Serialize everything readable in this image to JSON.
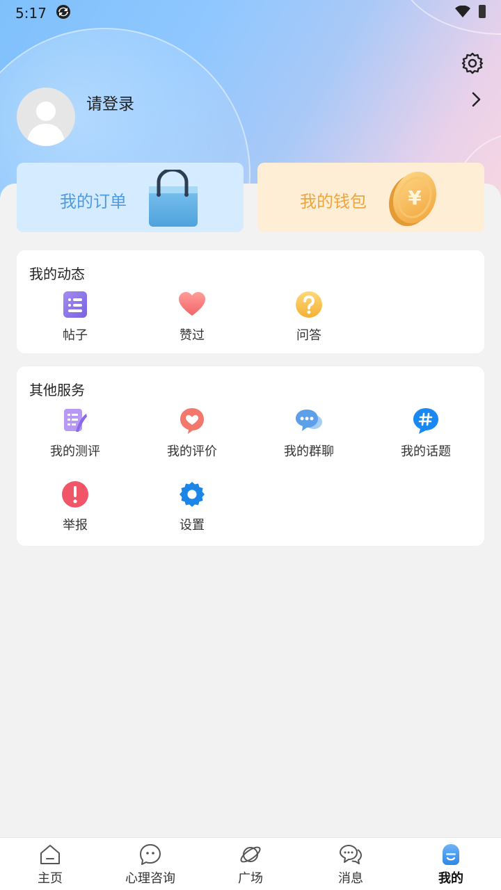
{
  "status_bar": {
    "time": "5:17"
  },
  "profile": {
    "login_text": "请登录"
  },
  "cards": {
    "orders_label": "我的订单",
    "wallet_label": "我的钱包",
    "coin_symbol": "¥"
  },
  "activity": {
    "title": "我的动态",
    "items": [
      {
        "label": "帖子",
        "icon": "post-icon"
      },
      {
        "label": "赞过",
        "icon": "heart-icon"
      },
      {
        "label": "问答",
        "icon": "question-icon"
      }
    ]
  },
  "services": {
    "title": "其他服务",
    "items": [
      {
        "label": "我的测评",
        "icon": "assessment-icon"
      },
      {
        "label": "我的评价",
        "icon": "review-icon"
      },
      {
        "label": "我的群聊",
        "icon": "group-chat-icon"
      },
      {
        "label": "我的话题",
        "icon": "topic-icon"
      },
      {
        "label": "举报",
        "icon": "report-icon"
      },
      {
        "label": "设置",
        "icon": "settings-icon"
      }
    ]
  },
  "tabbar": {
    "items": [
      {
        "label": "主页",
        "icon": "home-icon"
      },
      {
        "label": "心理咨询",
        "icon": "consult-icon"
      },
      {
        "label": "广场",
        "icon": "planet-icon"
      },
      {
        "label": "消息",
        "icon": "message-icon"
      },
      {
        "label": "我的",
        "icon": "profile-icon",
        "active": true
      }
    ]
  },
  "colors": {
    "accent_blue": "#4f9be0",
    "accent_orange": "#eba640",
    "orders_bg": "#d5ebff",
    "wallet_bg": "#ffeed6",
    "page_bg": "#f2f2f2"
  }
}
